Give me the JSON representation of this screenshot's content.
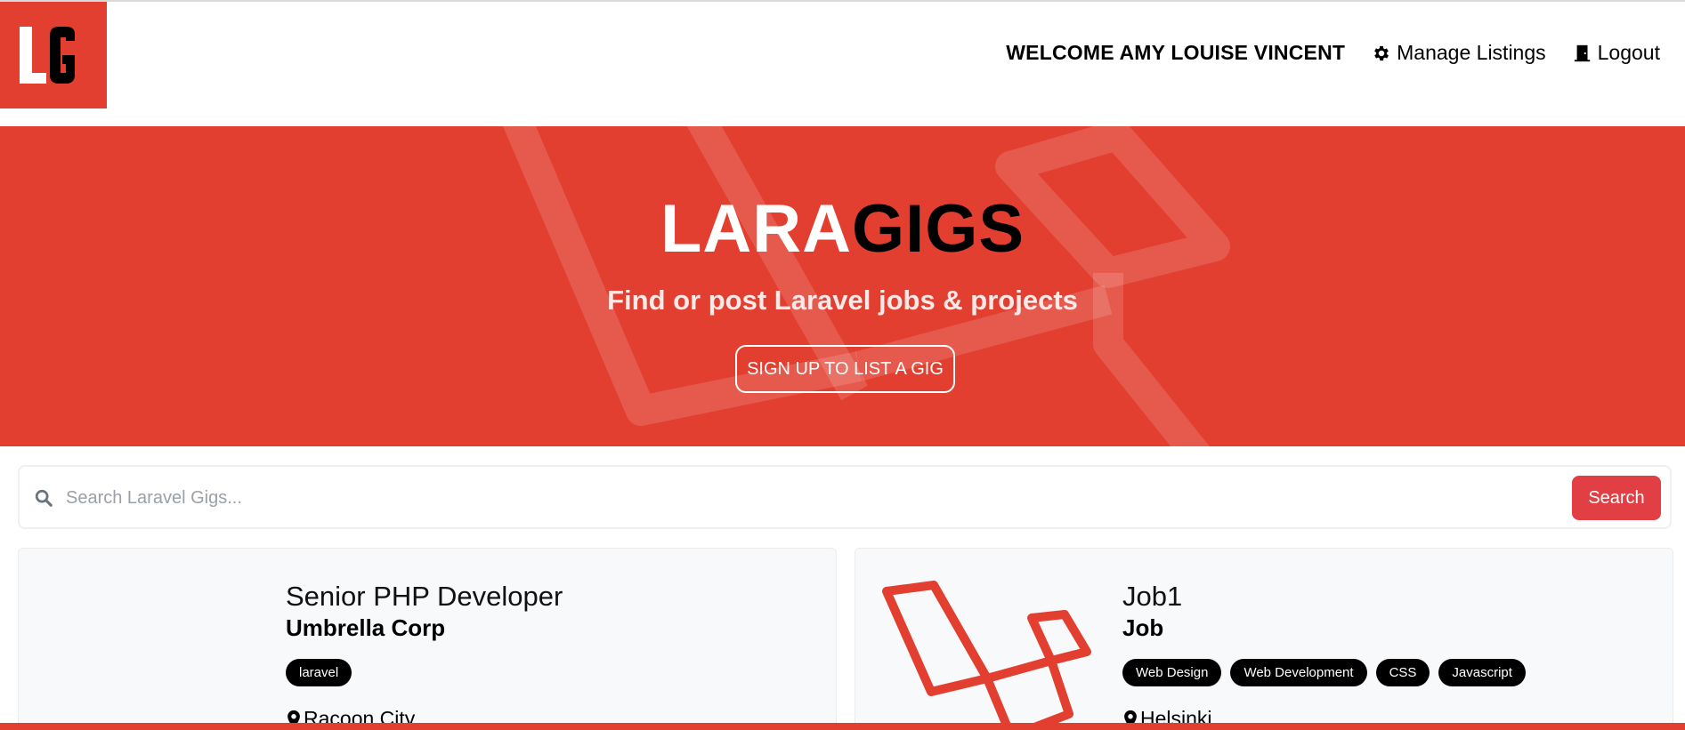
{
  "brand": {
    "logo_text": "LG",
    "accent": "#e23f30"
  },
  "nav": {
    "welcome": "WELCOME AMY LOUISE VINCENT",
    "manage_label": "Manage Listings",
    "manage_icon": "gear-icon",
    "logout_label": "Logout",
    "logout_icon": "door-icon"
  },
  "hero": {
    "title_white": "LARA",
    "title_black": "GIGS",
    "subtitle": "Find or post Laravel jobs & projects",
    "cta_label": "SIGN UP TO LIST A GIG"
  },
  "search": {
    "placeholder": "Search Laravel Gigs...",
    "button_label": "Search"
  },
  "listings": [
    {
      "title": "Senior PHP Developer",
      "company": "Umbrella Corp",
      "tags": [
        "laravel"
      ],
      "location": "Racoon City",
      "has_logo": false
    },
    {
      "title": "Job1",
      "company": "Job",
      "tags": [
        "Web Design",
        "Web Development",
        "CSS",
        "Javascript"
      ],
      "location": "Helsinki",
      "has_logo": true
    }
  ]
}
